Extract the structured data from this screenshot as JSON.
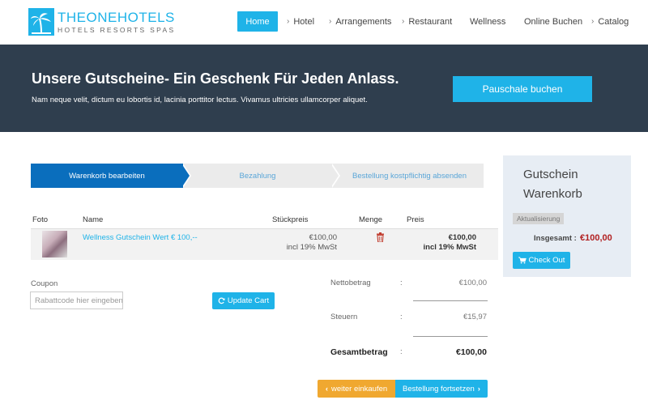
{
  "brand": {
    "name_part1": "THEONE",
    "name_part2": "HOTELS",
    "tagline": "HOTELS RESORTS SPAS"
  },
  "nav": {
    "items": [
      {
        "label": "Home",
        "active": true,
        "chevron": false
      },
      {
        "label": "Hotel",
        "chevron": true
      },
      {
        "label": "Arrangements",
        "chevron": true
      },
      {
        "label": "Restaurant",
        "chevron": true
      },
      {
        "label": "Wellness",
        "chevron": false
      },
      {
        "label": "Online Buchen",
        "chevron": false
      },
      {
        "label": "Catalog",
        "chevron": true
      }
    ]
  },
  "hero": {
    "title": "Unsere Gutscheine- Ein Geschenk Für Jeden Anlass.",
    "subtitle": "Nam neque velit, dictum eu lobortis id, lacinia porttitor lectus. Vivamus ultricies ullamcorper aliquet.",
    "button": "Pauschale buchen"
  },
  "steps": [
    {
      "label": "Warenkorb bearbeiten",
      "active": true
    },
    {
      "label": "Bezahlung",
      "active": false
    },
    {
      "label": "Bestellung kostpflichtig absenden",
      "active": false
    }
  ],
  "table": {
    "headers": [
      "Foto",
      "Name",
      "Stückpreis",
      "Menge",
      "Preis"
    ],
    "rows": [
      {
        "name": "Wellness Gutschein Wert € 100,--",
        "unit_price": "€100,00",
        "unit_tax": "incl 19% MwSt",
        "price": "€100,00",
        "price_tax": "incl 19% MwSt"
      }
    ]
  },
  "coupon": {
    "label": "Coupon",
    "placeholder": "Rabattcode hier eingeben",
    "update_button": "Update Cart"
  },
  "totals": {
    "netto_label": "Nettobetrag",
    "netto_value": "€100,00",
    "tax_label": "Steuern",
    "tax_value": "€15,97",
    "gross_label": "Gesamtbetrag",
    "gross_value": "€100,00",
    "colon": ":"
  },
  "actions": {
    "continue_shopping": "weiter einkaufen",
    "proceed": "Bestellung fortsetzen"
  },
  "cart": {
    "title": "Gutschein Warenkorb",
    "badge": "Aktualisierung",
    "total_label": "Insgesamt :",
    "total_value": "€100,00",
    "checkout": "Check Out"
  },
  "colors": {
    "accent": "#1fb3e8",
    "hero_bg": "#2f3e4e",
    "step_active": "#0a6ebd",
    "warning": "#f0a830",
    "total_red": "#b11f1f"
  }
}
